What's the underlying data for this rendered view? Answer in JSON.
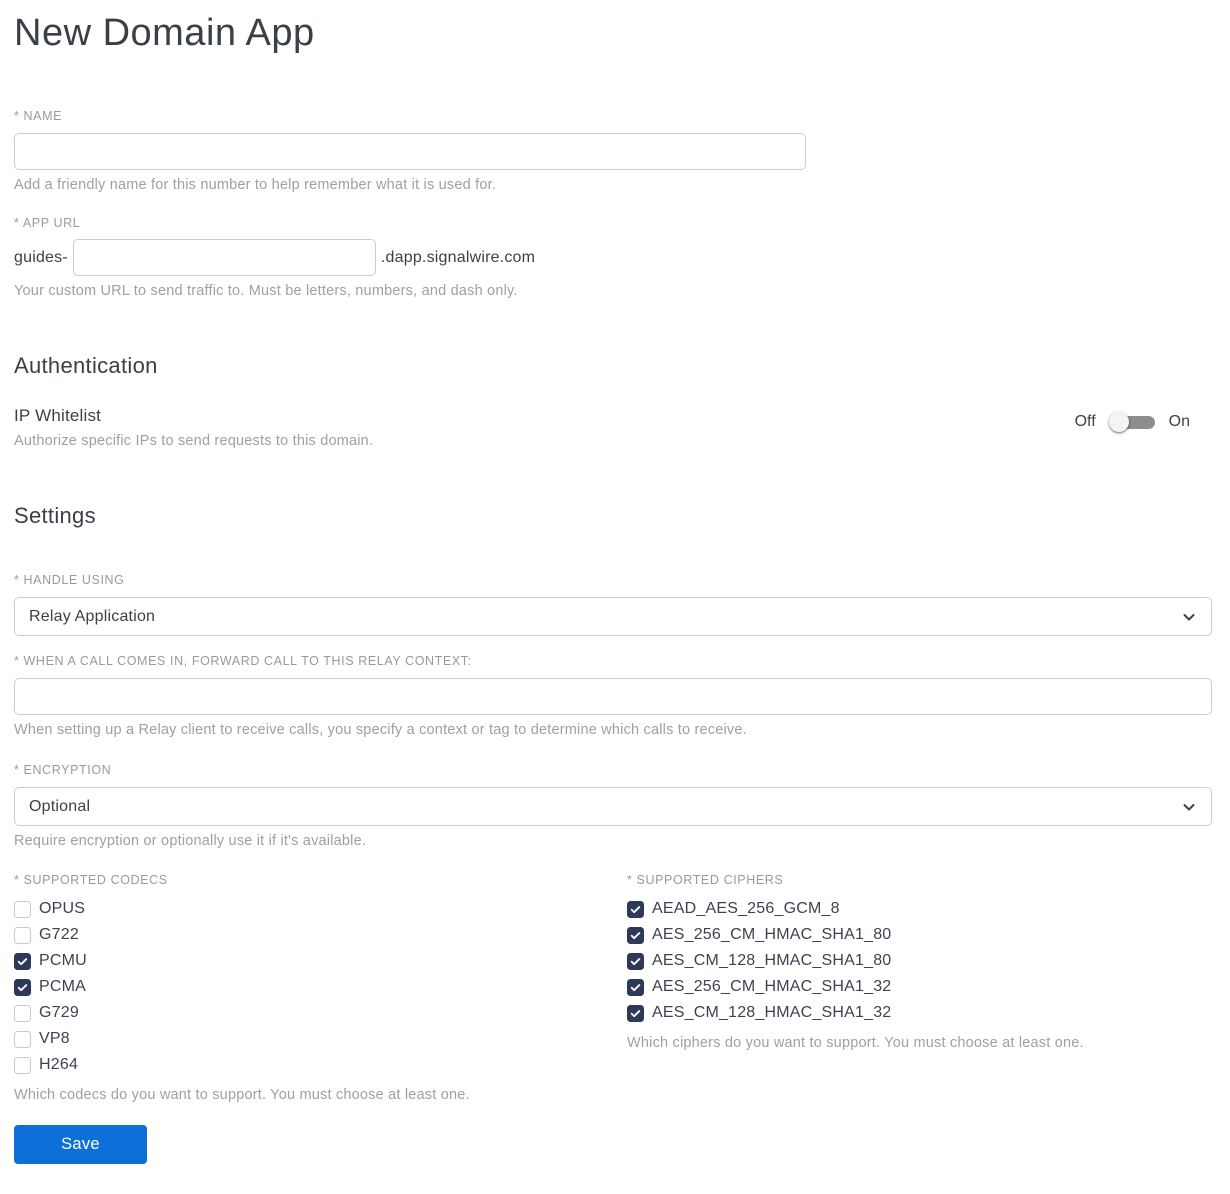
{
  "page": {
    "title": "New Domain App"
  },
  "name_field": {
    "label": "* NAME",
    "value": "",
    "helper": "Add a friendly name for this number to help remember what it is used for."
  },
  "app_url_field": {
    "label": "* APP URL",
    "prefix": "guides-",
    "value": "",
    "suffix": ".dapp.signalwire.com",
    "helper": "Your custom URL to send traffic to. Must be letters, numbers, and dash only."
  },
  "authentication": {
    "heading": "Authentication",
    "ip_whitelist_label": "IP Whitelist",
    "ip_whitelist_helper": "Authorize specific IPs to send requests to this domain.",
    "toggle_off": "Off",
    "toggle_on": "On",
    "toggle_state": "off"
  },
  "settings": {
    "heading": "Settings",
    "handle_using": {
      "label": "* HANDLE USING",
      "value": "Relay Application"
    },
    "relay_context": {
      "label": "* WHEN A CALL COMES IN, FORWARD CALL TO THIS RELAY CONTEXT:",
      "value": "",
      "helper": "When setting up a Relay client to receive calls, you specify a context or tag to determine which calls to receive."
    },
    "encryption": {
      "label": "* ENCRYPTION",
      "value": "Optional",
      "helper": "Require encryption or optionally use it if it's available."
    },
    "codecs": {
      "label": "* SUPPORTED CODECS",
      "helper": "Which codecs do you want to support. You must choose at least one.",
      "options": [
        {
          "label": "OPUS",
          "checked": false
        },
        {
          "label": "G722",
          "checked": false
        },
        {
          "label": "PCMU",
          "checked": true
        },
        {
          "label": "PCMA",
          "checked": true
        },
        {
          "label": "G729",
          "checked": false
        },
        {
          "label": "VP8",
          "checked": false
        },
        {
          "label": "H264",
          "checked": false
        }
      ]
    },
    "ciphers": {
      "label": "* SUPPORTED CIPHERS",
      "helper": "Which ciphers do you want to support. You must choose at least one.",
      "options": [
        {
          "label": "AEAD_AES_256_GCM_8",
          "checked": true
        },
        {
          "label": "AES_256_CM_HMAC_SHA1_80",
          "checked": true
        },
        {
          "label": "AES_CM_128_HMAC_SHA1_80",
          "checked": true
        },
        {
          "label": "AES_256_CM_HMAC_SHA1_32",
          "checked": true
        },
        {
          "label": "AES_CM_128_HMAC_SHA1_32",
          "checked": true
        }
      ]
    }
  },
  "actions": {
    "save_label": "Save"
  },
  "colors": {
    "accent_blue": "#0d6fd8",
    "checkbox_checked": "#2d3958",
    "toggle_track": "#8d8d8d",
    "border": "#c9ced3",
    "text_dark": "#3b4148",
    "text_muted": "#9aa1a9"
  }
}
